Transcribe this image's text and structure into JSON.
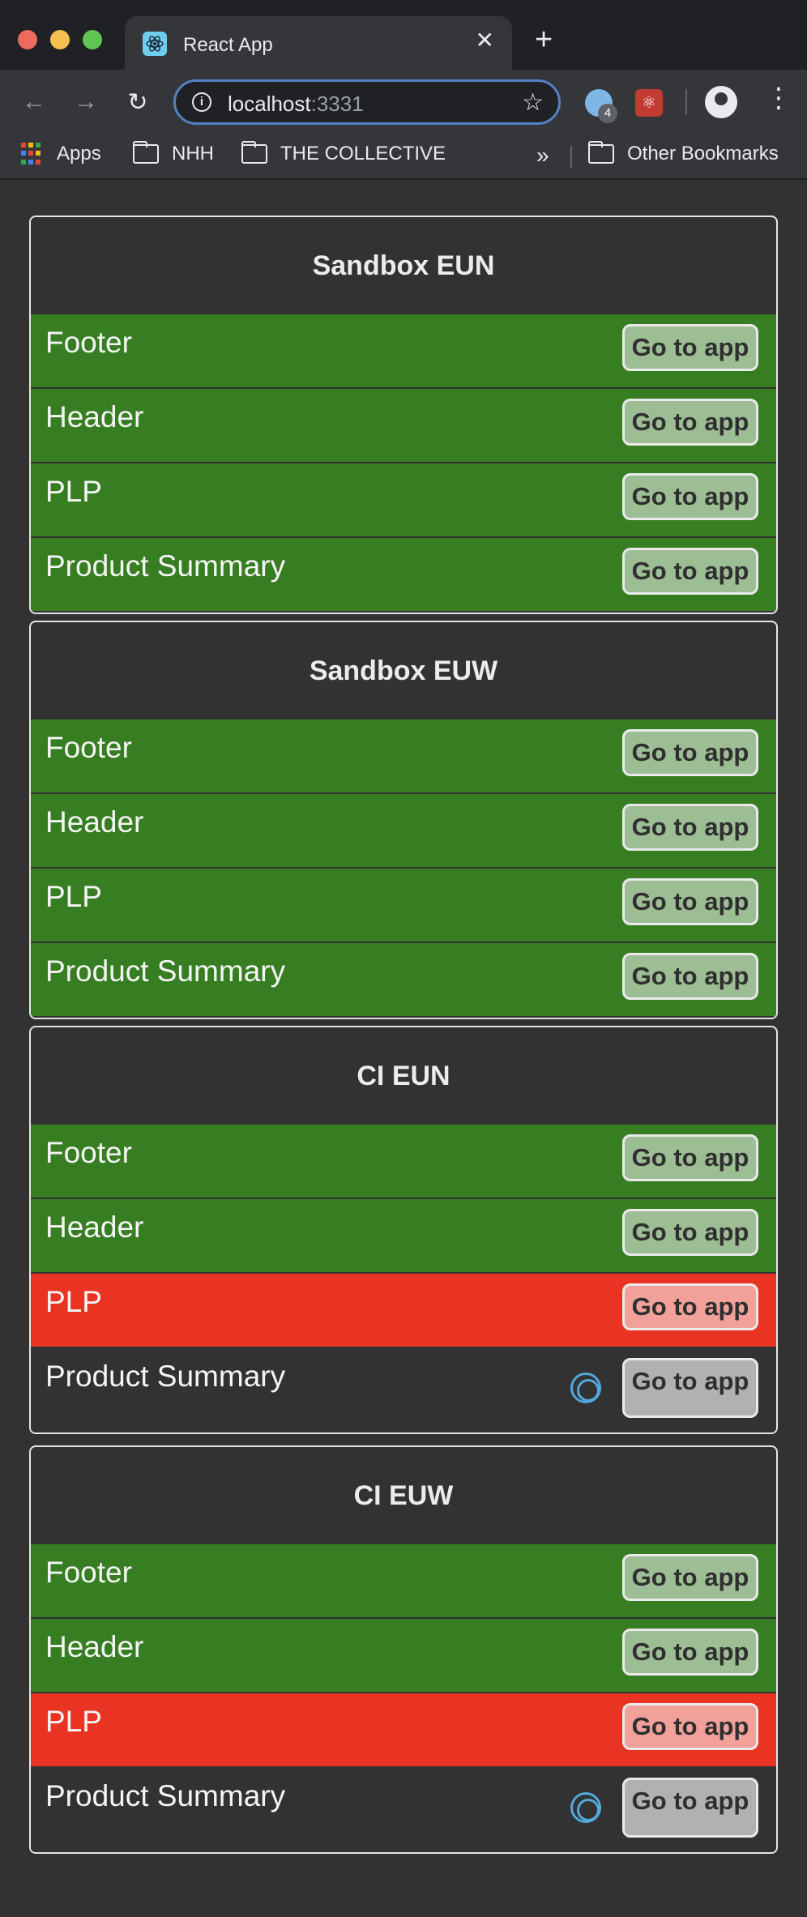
{
  "browser": {
    "tab_title": "React App",
    "url_host": "localhost",
    "url_port": ":3331",
    "extension_badge": "4",
    "bookmarks": [
      {
        "label": "Apps",
        "icon": "apps-grid-icon"
      },
      {
        "label": "NHH",
        "icon": "folder-icon"
      },
      {
        "label": "THE COLLECTIVE",
        "icon": "folder-icon"
      }
    ],
    "overflow_label": "»",
    "other_bookmarks": "Other Bookmarks"
  },
  "button_label": "Go to app",
  "status_colors": {
    "ok": "#367e21",
    "fail": "#e93323",
    "pending": "#323233"
  },
  "cards": [
    {
      "title": "Sandbox EUN",
      "rows": [
        {
          "label": "Footer",
          "status": "ok"
        },
        {
          "label": "Header",
          "status": "ok"
        },
        {
          "label": "PLP",
          "status": "ok"
        },
        {
          "label": "Product Summary",
          "status": "ok"
        }
      ]
    },
    {
      "title": "Sandbox EUW",
      "rows": [
        {
          "label": "Footer",
          "status": "ok"
        },
        {
          "label": "Header",
          "status": "ok"
        },
        {
          "label": "PLP",
          "status": "ok"
        },
        {
          "label": "Product Summary",
          "status": "ok"
        }
      ]
    },
    {
      "title": "CI EUN",
      "rows": [
        {
          "label": "Footer",
          "status": "ok"
        },
        {
          "label": "Header",
          "status": "ok"
        },
        {
          "label": "PLP",
          "status": "fail"
        },
        {
          "label": "Product Summary",
          "status": "pending"
        }
      ]
    },
    {
      "title": "CI EUW",
      "rows": [
        {
          "label": "Footer",
          "status": "ok"
        },
        {
          "label": "Header",
          "status": "ok"
        },
        {
          "label": "PLP",
          "status": "fail"
        },
        {
          "label": "Product Summary",
          "status": "pending"
        }
      ]
    }
  ]
}
